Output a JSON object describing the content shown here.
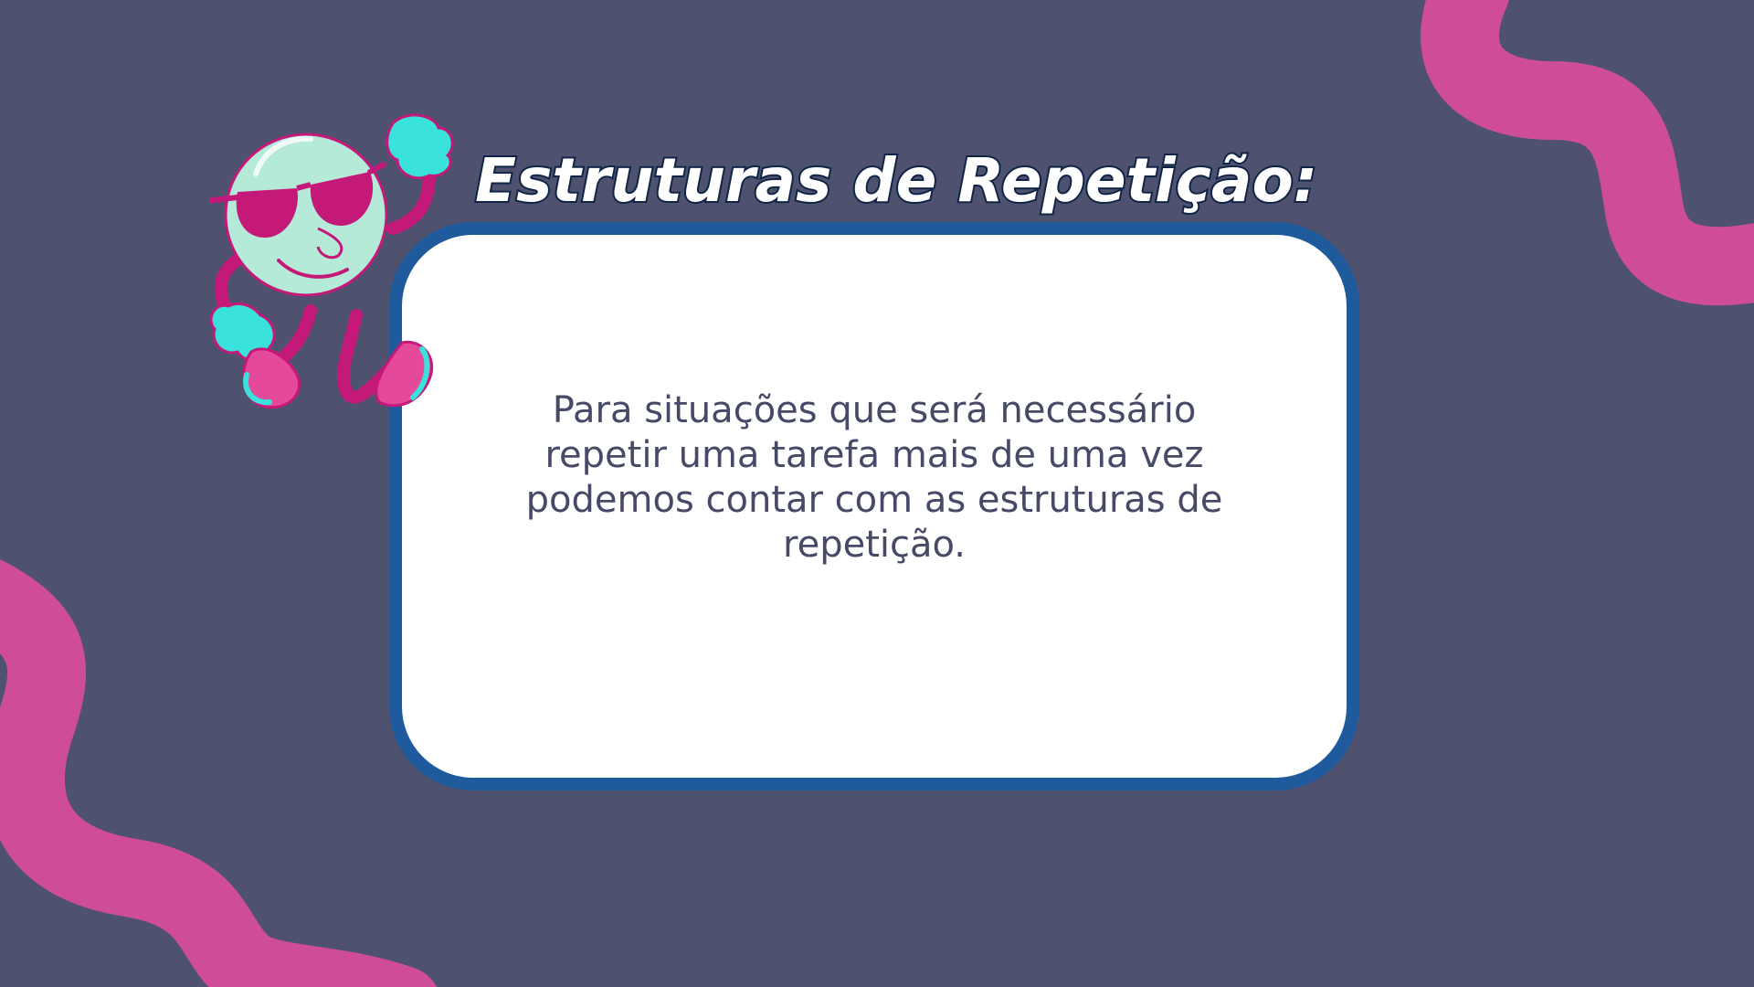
{
  "slide": {
    "title": "Estruturas de Repetição:",
    "body_text": "Para situações que será necessário repetir uma tarefa mais de uma vez podemos contar com as estruturas de repetição."
  },
  "colors": {
    "background": "#4e526f",
    "accent_pink": "#cf4d98",
    "card_border": "#1e5a9c",
    "card_fill": "#ffffff",
    "title_fill": "#ffffff",
    "title_outline": "#0f2447",
    "body_text": "#474a66",
    "mascot_face": "#b5ead8",
    "mascot_accent": "#c5197a",
    "mascot_gloves": "#39e3dc"
  },
  "icons": {
    "mascot": "cartoon-ball-with-sunglasses-icon",
    "decor_top_right": "pink-squiggle-decoration",
    "decor_bottom_left": "pink-squiggle-decoration"
  }
}
